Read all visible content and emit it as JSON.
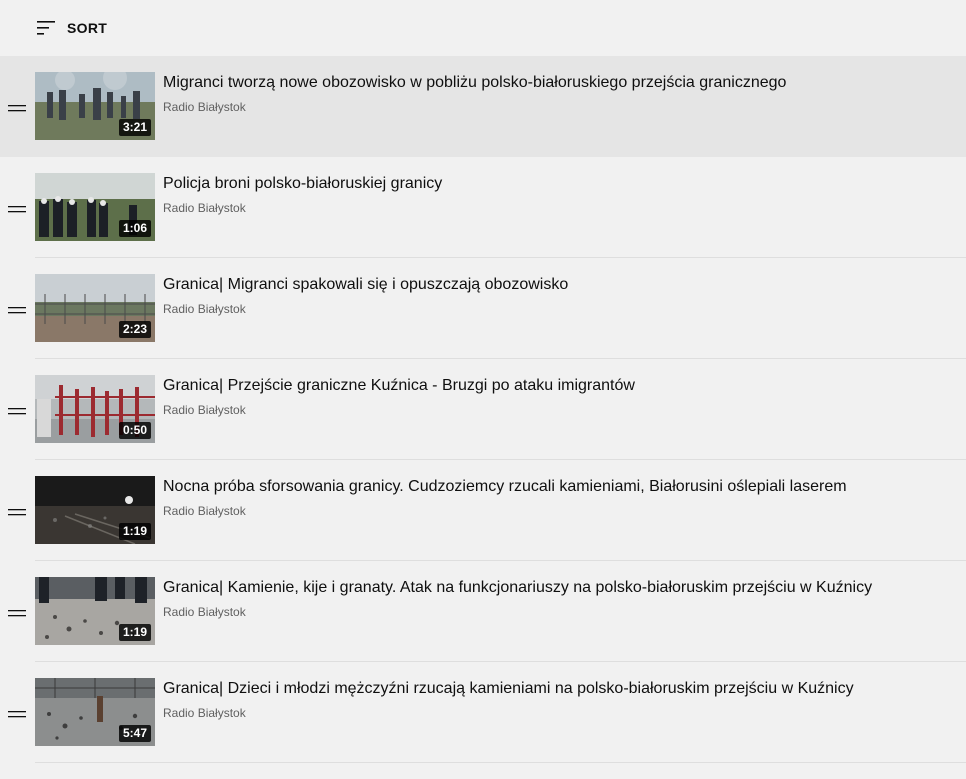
{
  "sort": {
    "label": "SORT",
    "icon": "sort-icon"
  },
  "playlist": {
    "items": [
      {
        "title": "Migranci tworzą nowe obozowisko w pobliżu polsko-białoruskiego przejścia granicznego",
        "channel": "Radio Białystok",
        "duration": "3:21",
        "selected": true
      },
      {
        "title": "Policja broni polsko-białoruskiej granicy",
        "channel": "Radio Białystok",
        "duration": "1:06",
        "selected": false
      },
      {
        "title": "Granica| Migranci spakowali się i opuszczają obozowisko",
        "channel": "Radio Białystok",
        "duration": "2:23",
        "selected": false
      },
      {
        "title": "Granica| Przejście graniczne Kuźnica - Bruzgi po ataku imigrantów",
        "channel": "Radio Białystok",
        "duration": "0:50",
        "selected": false
      },
      {
        "title": "Nocna próba sforsowania granicy. Cudzoziemcy rzucali kamieniami, Białorusini oślepiali laserem",
        "channel": "Radio Białystok",
        "duration": "1:19",
        "selected": false
      },
      {
        "title": "Granica| Kamienie, kije i granaty. Atak na funkcjonariuszy na polsko-białoruskim przejściu w Kuźnicy",
        "channel": "Radio Białystok",
        "duration": "1:19",
        "selected": false
      },
      {
        "title": "Granica| Dzieci i młodzi mężczyźni rzucają kamieniami na polsko-białoruskim przejściu w Kuźnicy",
        "channel": "Radio Białystok",
        "duration": "5:47",
        "selected": false
      }
    ]
  }
}
